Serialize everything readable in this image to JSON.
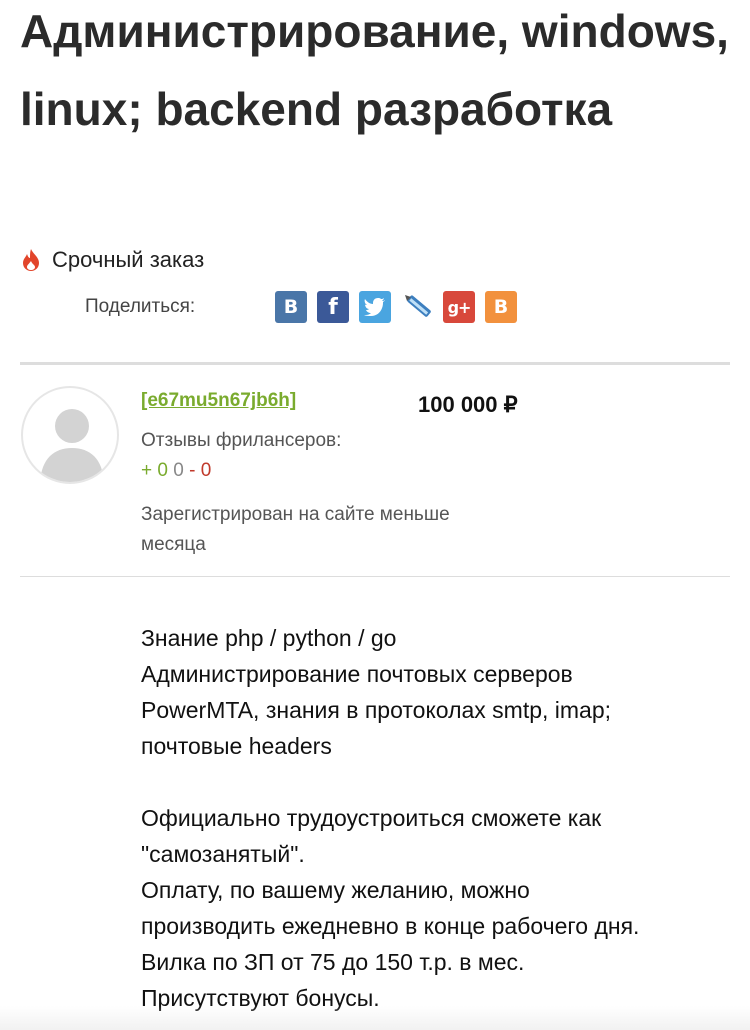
{
  "title": "Администрирование, windows, linux; backend разработка",
  "urgent": {
    "label": "Срочный заказ",
    "icon": "fire-icon"
  },
  "share": {
    "label": "Поделиться:",
    "networks": [
      {
        "name": "vk-icon",
        "glyph": "В",
        "color": "#4a76a8"
      },
      {
        "name": "facebook-icon",
        "glyph": "f",
        "color": "#3b5998"
      },
      {
        "name": "twitter-icon",
        "glyph": "t",
        "color": "#4aa5e0"
      },
      {
        "name": "livejournal-icon",
        "glyph": "",
        "color": "#3d7fbf"
      },
      {
        "name": "google-plus-icon",
        "glyph": "g+",
        "color": "#d8483b"
      },
      {
        "name": "blogger-icon",
        "glyph": "B",
        "color": "#f2913d"
      }
    ]
  },
  "author": {
    "username": "[e67mu5n67jb6h]",
    "reviews_label": "Отзывы фрилансеров:",
    "reviews": {
      "positive": "+ 0",
      "neutral": "0",
      "negative": "- 0"
    },
    "registered": "Зарегистрирован на сайте меньше месяца"
  },
  "price": "100 000 ₽",
  "description": {
    "lines_1": [
      "Знание php / python / go",
      "Администрирование почтовых серверов",
      "PowerMTA, знания в протоколах smtp, imap;",
      "почтовые headers"
    ],
    "lines_2": [
      "Официально трудоустроиться сможете как",
      "\"самозанятый\".",
      "Оплату, по вашему желанию, можно",
      "производить ежедневно в конце рабочего дня.",
      "Вилка по ЗП от 75 до 150 т.р. в мес.",
      "Присутствуют бонусы."
    ]
  },
  "colors": {
    "accent_green": "#7aab2e",
    "negative_red": "#c0392b"
  }
}
